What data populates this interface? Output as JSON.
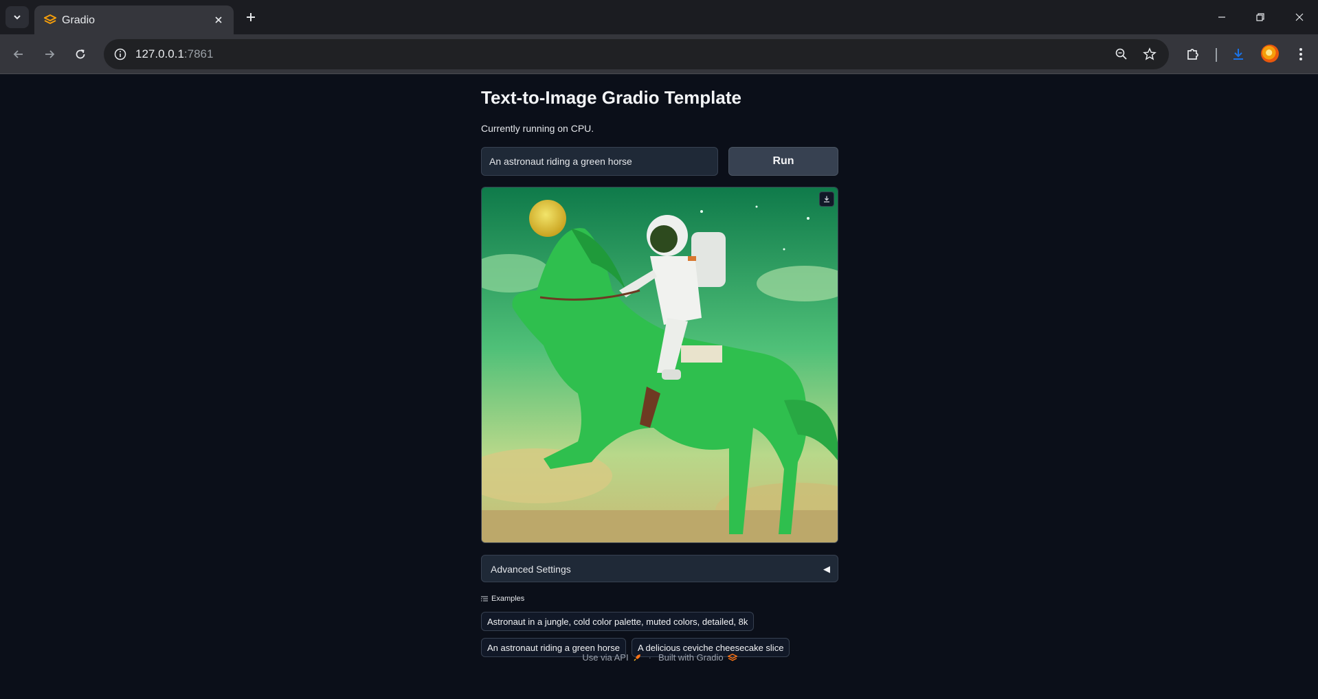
{
  "browser": {
    "tab_title": "Gradio",
    "url_host": "127.0.0.1",
    "url_port": ":7861"
  },
  "app": {
    "title": "Text-to-Image Gradio Template",
    "subtitle": "Currently running on CPU.",
    "prompt_value": "An astronaut riding a green horse",
    "run_label": "Run",
    "accordion_label": "Advanced Settings",
    "accordion_arrow": "◀",
    "examples_label": "Examples",
    "examples": [
      "Astronaut in a jungle, cold color palette, muted colors, detailed, 8k",
      "An astronaut riding a green horse",
      "A delicious ceviche cheesecake slice"
    ],
    "footer": {
      "api_label": "Use via API",
      "separator": "·",
      "built_label": "Built with Gradio"
    }
  },
  "colors": {
    "background": "#0b0f19",
    "accent": "#f97316"
  }
}
